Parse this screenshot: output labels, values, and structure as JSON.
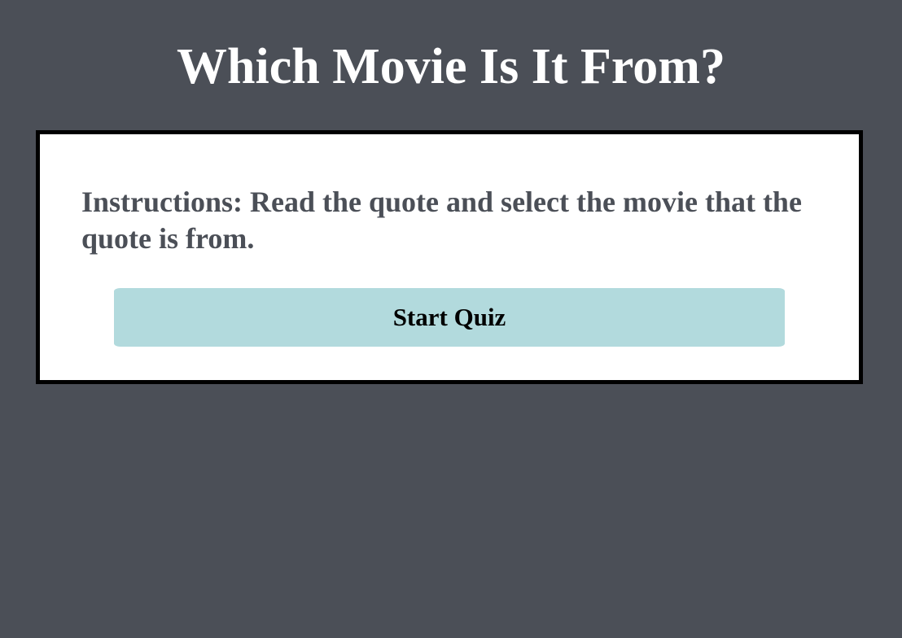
{
  "page": {
    "title": "Which Movie Is It From?"
  },
  "card": {
    "instructions": "Instructions: Read the quote and select the movie that the quote is from.",
    "start_button_label": "Start Quiz"
  },
  "colors": {
    "background": "#4b4f57",
    "card": "#ffffff",
    "card_border": "#000000",
    "button": "#b2dadd",
    "instructions_text": "#4b4f57"
  }
}
